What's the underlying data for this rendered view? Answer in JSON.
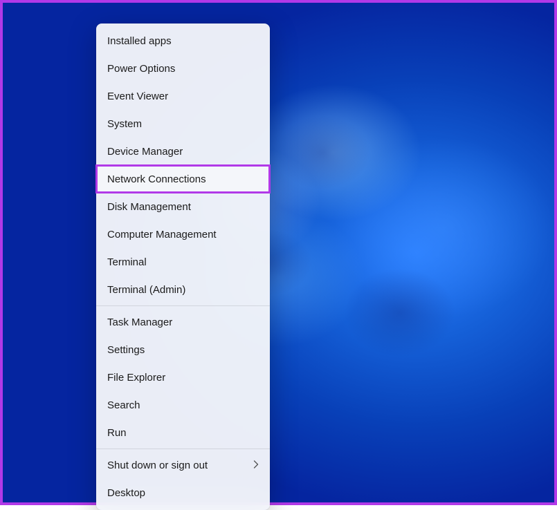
{
  "highlight_color": "#b139e8",
  "highlighted_index": 5,
  "menu": {
    "groups": [
      [
        {
          "label": "Installed apps",
          "id": "installed-apps",
          "submenu": false
        },
        {
          "label": "Power Options",
          "id": "power-options",
          "submenu": false
        },
        {
          "label": "Event Viewer",
          "id": "event-viewer",
          "submenu": false
        },
        {
          "label": "System",
          "id": "system",
          "submenu": false
        },
        {
          "label": "Device Manager",
          "id": "device-manager",
          "submenu": false
        },
        {
          "label": "Network Connections",
          "id": "network-connections",
          "submenu": false
        },
        {
          "label": "Disk Management",
          "id": "disk-management",
          "submenu": false
        },
        {
          "label": "Computer Management",
          "id": "computer-management",
          "submenu": false
        },
        {
          "label": "Terminal",
          "id": "terminal",
          "submenu": false
        },
        {
          "label": "Terminal (Admin)",
          "id": "terminal-admin",
          "submenu": false
        }
      ],
      [
        {
          "label": "Task Manager",
          "id": "task-manager",
          "submenu": false
        },
        {
          "label": "Settings",
          "id": "settings",
          "submenu": false
        },
        {
          "label": "File Explorer",
          "id": "file-explorer",
          "submenu": false
        },
        {
          "label": "Search",
          "id": "search",
          "submenu": false
        },
        {
          "label": "Run",
          "id": "run",
          "submenu": false
        }
      ],
      [
        {
          "label": "Shut down or sign out",
          "id": "shut-down-or-sign-out",
          "submenu": true
        },
        {
          "label": "Desktop",
          "id": "desktop",
          "submenu": false
        }
      ]
    ]
  }
}
